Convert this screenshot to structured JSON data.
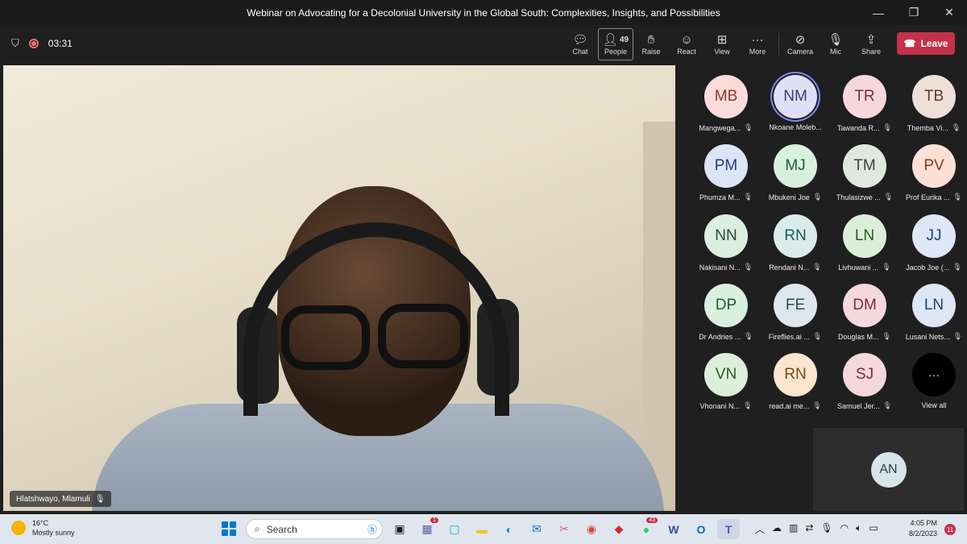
{
  "window": {
    "title": "Webinar on Advocating for a Decolonial University in the Global South: Complexities, Insights, and Possibilities",
    "controls": [
      "—",
      "❐",
      "✕"
    ]
  },
  "meeting": {
    "timer": "03:31"
  },
  "toolbar": {
    "chat": "Chat",
    "people": "People",
    "people_count": "49",
    "raise": "Raise",
    "react": "React",
    "view": "View",
    "more": "More",
    "camera": "Camera",
    "mic": "Mic",
    "share": "Share",
    "leave": "Leave"
  },
  "speaker": {
    "name": "Hlatshwayo, Mlamuli"
  },
  "participants": [
    {
      "initials": "MB",
      "name": "Mangwega...",
      "bg": "#f9dcd9",
      "fg": "#8b3a2f",
      "muted": true
    },
    {
      "initials": "NM",
      "name": "Nkoane Moleb...",
      "bg": "#dfe0f5",
      "fg": "#373a7a",
      "muted": false,
      "active": true
    },
    {
      "initials": "TR",
      "name": "Tawanda R...",
      "bg": "#f6d8dc",
      "fg": "#7c2b3a",
      "muted": true
    },
    {
      "initials": "TB",
      "name": "Themba Vi...",
      "bg": "#eedfd8",
      "fg": "#5b3b31",
      "muted": true
    },
    {
      "initials": "PM",
      "name": "Phumza M...",
      "bg": "#dbe5f5",
      "fg": "#223f74",
      "muted": true
    },
    {
      "initials": "MJ",
      "name": "Mbukeni Joe",
      "bg": "#d9f0df",
      "fg": "#1e5e33",
      "muted": true
    },
    {
      "initials": "TM",
      "name": "Thulasizwe ...",
      "bg": "#dfe7df",
      "fg": "#33473a",
      "muted": true
    },
    {
      "initials": "PV",
      "name": "Prof Eurika ...",
      "bg": "#fbe0d5",
      "fg": "#8b3a1a",
      "muted": true
    },
    {
      "initials": "NN",
      "name": "Nakisani N...",
      "bg": "#dbeedf",
      "fg": "#23503a",
      "muted": true
    },
    {
      "initials": "RN",
      "name": "Rendani N...",
      "bg": "#d9ece9",
      "fg": "#1e5a55",
      "muted": true
    },
    {
      "initials": "LN",
      "name": "Livhuwani ...",
      "bg": "#dbeed9",
      "fg": "#2b5a26",
      "muted": true
    },
    {
      "initials": "JJ",
      "name": "Jacob Joe (...",
      "bg": "#dde7f7",
      "fg": "#243f78",
      "muted": true
    },
    {
      "initials": "DP",
      "name": "Dr Andries ...",
      "bg": "#d9f0df",
      "fg": "#1e5e33",
      "muted": true
    },
    {
      "initials": "FE",
      "name": "Fireflies.ai ...",
      "bg": "#dde8ee",
      "fg": "#2c4654",
      "muted": true
    },
    {
      "initials": "DM",
      "name": "Douglas M...",
      "bg": "#f5d8de",
      "fg": "#7a2a3c",
      "muted": true
    },
    {
      "initials": "LN",
      "name": "Lusani Nets...",
      "bg": "#dde7f5",
      "fg": "#243f74",
      "muted": true
    },
    {
      "initials": "VN",
      "name": "Vhonani N...",
      "bg": "#ddefdb",
      "fg": "#2b5a26",
      "muted": true
    },
    {
      "initials": "RN",
      "name": "read.ai me...",
      "bg": "#fbe5cf",
      "fg": "#7a4a14",
      "muted": true
    },
    {
      "initials": "SJ",
      "name": "Samuel Jer...",
      "bg": "#f5d8de",
      "fg": "#7a2a3c",
      "muted": true
    }
  ],
  "view_all": {
    "icon": "···",
    "label": "View all"
  },
  "self_view": {
    "initials": "AN"
  },
  "taskbar": {
    "temperature": "16°C",
    "weather": "Mostly sunny",
    "search": "Search",
    "time": "4:05 PM",
    "date": "8/2/2023",
    "notifications": "11",
    "badge_1": "1",
    "badge_43": "43"
  }
}
